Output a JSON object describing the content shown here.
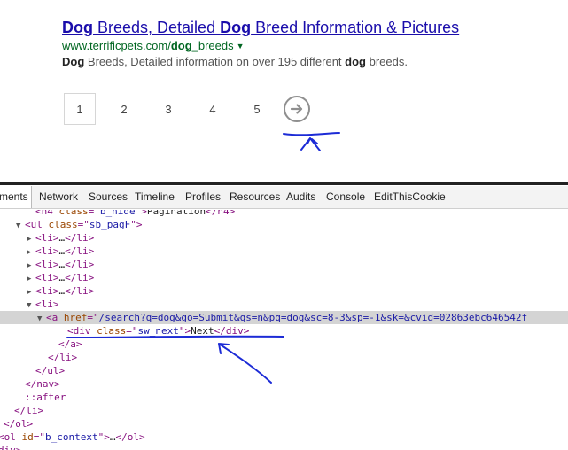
{
  "result": {
    "title_1": "Dog",
    "title_2": " Breeds, Detailed ",
    "title_3": "Dog",
    "title_4": " Breed Information & Pictures",
    "url_1": "www.terrificpets.com/",
    "url_2": "dog",
    "url_3": "_breeds",
    "snippet_1": "Dog",
    "snippet_2": " Breeds, Detailed information on over 195 different ",
    "snippet_3": "dog",
    "snippet_4": " breeds."
  },
  "pager": {
    "pages": [
      "1",
      "2",
      "3",
      "4",
      "5"
    ],
    "current": "1"
  },
  "devtools": {
    "tabs": [
      "ments",
      "Network",
      "Sources",
      "Timeline",
      "Profiles",
      "Resources",
      "Audits",
      "Console",
      "EditThisCookie"
    ],
    "lines": [
      {
        "indent": 40,
        "tri": "",
        "html": [
          [
            "tag",
            "<h4 "
          ],
          [
            "an",
            "class"
          ],
          [
            "tag",
            "=\""
          ],
          [
            "av",
            "b_hide"
          ],
          [
            "tag",
            "\">"
          ],
          [
            "tx",
            "Pagination"
          ],
          [
            "tag",
            "</h4>"
          ]
        ]
      },
      {
        "indent": 30,
        "tri": "▼",
        "html": [
          [
            "tag",
            "<ul "
          ],
          [
            "an",
            "class"
          ],
          [
            "tag",
            "=\""
          ],
          [
            "av",
            "sb_pagF"
          ],
          [
            "tag",
            "\">"
          ]
        ]
      },
      {
        "indent": 42,
        "tri": "▶",
        "html": [
          [
            "tag",
            "<li>"
          ],
          [
            "tx",
            "…"
          ],
          [
            "tag",
            "</li>"
          ]
        ]
      },
      {
        "indent": 42,
        "tri": "▶",
        "html": [
          [
            "tag",
            "<li>"
          ],
          [
            "tx",
            "…"
          ],
          [
            "tag",
            "</li>"
          ]
        ]
      },
      {
        "indent": 42,
        "tri": "▶",
        "html": [
          [
            "tag",
            "<li>"
          ],
          [
            "tx",
            "…"
          ],
          [
            "tag",
            "</li>"
          ]
        ]
      },
      {
        "indent": 42,
        "tri": "▶",
        "html": [
          [
            "tag",
            "<li>"
          ],
          [
            "tx",
            "…"
          ],
          [
            "tag",
            "</li>"
          ]
        ]
      },
      {
        "indent": 42,
        "tri": "▶",
        "html": [
          [
            "tag",
            "<li>"
          ],
          [
            "tx",
            "…"
          ],
          [
            "tag",
            "</li>"
          ]
        ]
      },
      {
        "indent": 42,
        "tri": "▼",
        "html": [
          [
            "tag",
            "<li>"
          ]
        ]
      },
      {
        "indent": 54,
        "tri": "▼",
        "sel": true,
        "html": [
          [
            "tag",
            "<a "
          ],
          [
            "an",
            "href"
          ],
          [
            "tag",
            "=\""
          ],
          [
            "av",
            "/search?q=dog&go=Submit&qs=n&pq=dog&sc=8-3&sp=-1&sk=&cvid=02863ebc646542f"
          ]
        ]
      },
      {
        "indent": 76,
        "tri": "",
        "html": [
          [
            "tag",
            "<div "
          ],
          [
            "an",
            "class"
          ],
          [
            "tag",
            "=\""
          ],
          [
            "av",
            "sw_next"
          ],
          [
            "tag",
            "\">"
          ],
          [
            "tx",
            "Next"
          ],
          [
            "tag",
            "</div>"
          ]
        ]
      },
      {
        "indent": 66,
        "tri": "",
        "html": [
          [
            "tag",
            "</a>"
          ]
        ]
      },
      {
        "indent": 54,
        "tri": "",
        "html": [
          [
            "tag",
            "</li>"
          ]
        ]
      },
      {
        "indent": 40,
        "tri": "",
        "html": [
          [
            "tag",
            "</ul>"
          ]
        ]
      },
      {
        "indent": 28,
        "tri": "",
        "html": [
          [
            "tag",
            "</nav>"
          ]
        ]
      },
      {
        "indent": 28,
        "tri": "",
        "html": [
          [
            "pseudo",
            "::after"
          ]
        ]
      },
      {
        "indent": 16,
        "tri": "",
        "html": [
          [
            "tag",
            "</li>"
          ]
        ]
      },
      {
        "indent": 4,
        "tri": "",
        "html": [
          [
            "tag",
            "</ol>"
          ]
        ]
      },
      {
        "indent": -2,
        "tri": "",
        "html": [
          [
            "tag",
            "<ol "
          ],
          [
            "an",
            "id"
          ],
          [
            "tag",
            "=\""
          ],
          [
            "av",
            "b_context"
          ],
          [
            "tag",
            "\">"
          ],
          [
            "tx",
            "…"
          ],
          [
            "tag",
            "</ol>"
          ]
        ]
      },
      {
        "indent": -2,
        "tri": "",
        "html": [
          [
            "tag",
            "div>"
          ]
        ]
      }
    ]
  }
}
